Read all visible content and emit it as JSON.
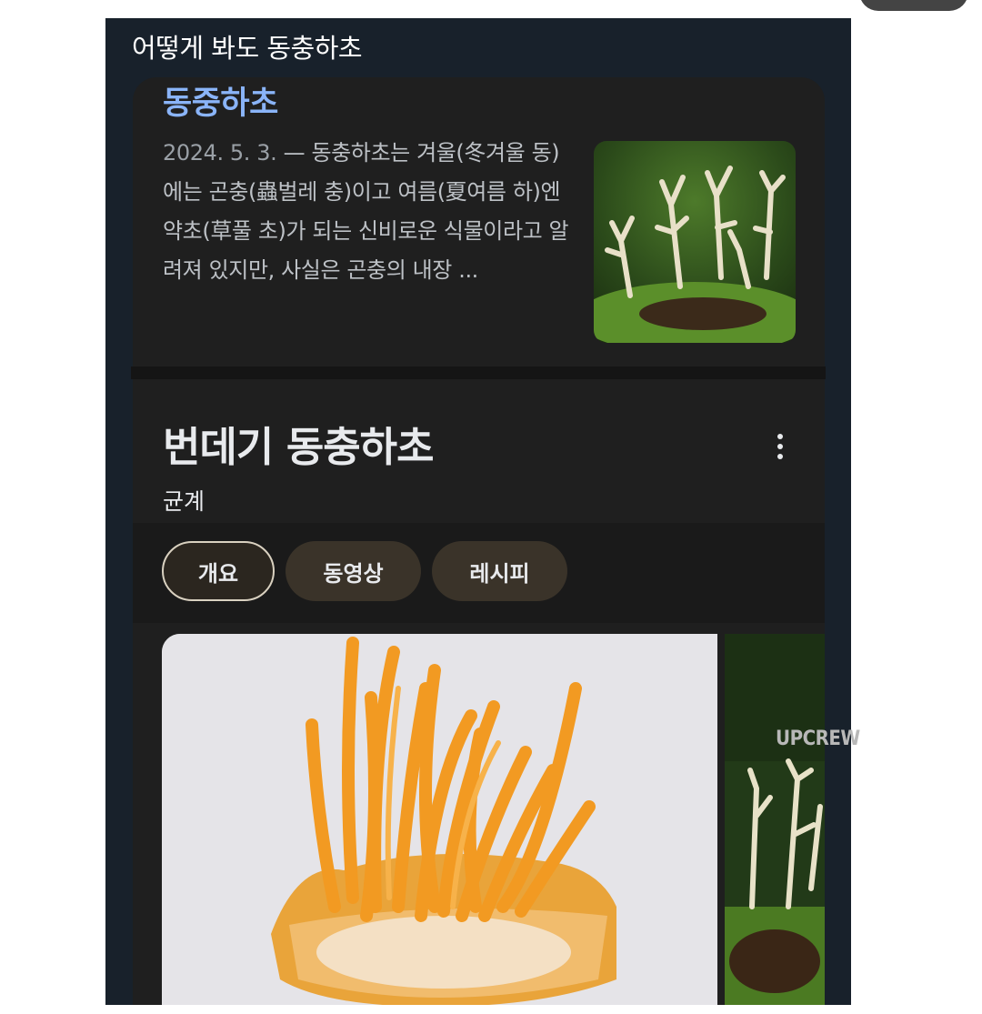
{
  "post": {
    "title": "어떻게 봐도 동충하초"
  },
  "result": {
    "title": "동중하초",
    "date": "2024. 5. 3.",
    "separator": " — ",
    "snippet": "동충하초는 겨울(冬겨울 동)에는 곤충(蟲벌레 충)이고 여름(夏여름 하)엔 약초(草풀 초)가 되는 신비로운 식물이라고 알려져 있지만, 사실은 곤충의 내장 ..."
  },
  "entity": {
    "title": "번데기 동충하초",
    "subtitle": "균계",
    "more_icon": "more-vert-icon",
    "chips": [
      {
        "label": "개요",
        "active": true
      },
      {
        "label": "동영상",
        "active": false
      },
      {
        "label": "레시피",
        "active": false
      }
    ]
  },
  "watermark": "UPCREW",
  "colors": {
    "background": "#18212b",
    "card": "#1f1f1f",
    "link_title": "#8ab4f8",
    "snippet_text": "#bdc1c6",
    "chip_active_border": "#d9d1c0",
    "chip_inactive": "#3a3329"
  }
}
